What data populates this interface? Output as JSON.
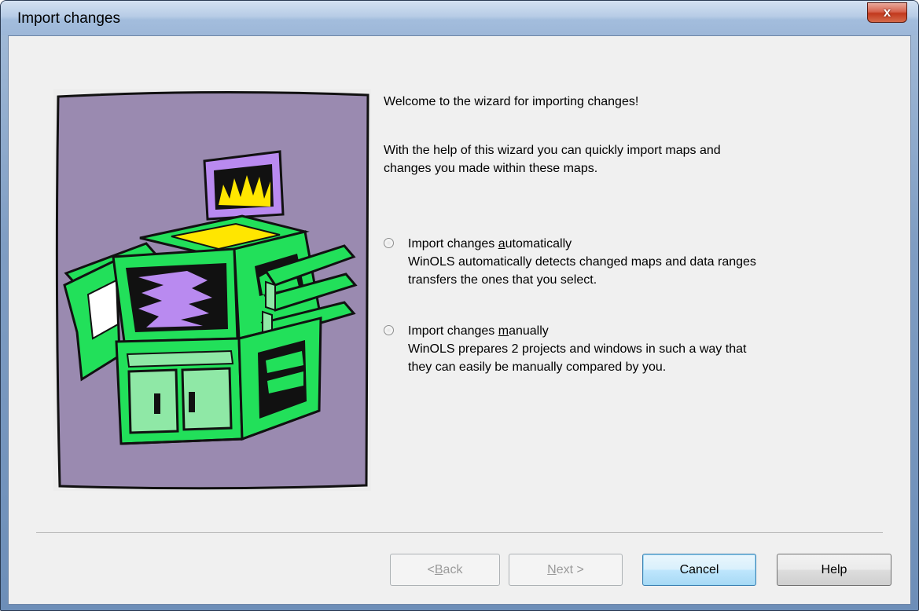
{
  "window": {
    "title": "Import changes",
    "close_glyph": "x"
  },
  "wizard": {
    "welcome": "Welcome to the wizard for importing changes!",
    "help_line1": "With the help of this wizard you can quickly import maps and",
    "help_line2": "changes you made within these maps.",
    "illustration": "printer-illustration-icon"
  },
  "options": [
    {
      "label_pre": "Import changes ",
      "label_accel": "a",
      "label_post": "utomatically",
      "desc_line1": "WinOLS automatically detects changed maps and data ranges",
      "desc_line2": "transfers the ones that you select.",
      "selected": false
    },
    {
      "label_pre": "Import changes ",
      "label_accel": "m",
      "label_post": "anually",
      "desc_line1": "WinOLS prepares 2 projects and windows in such a way that",
      "desc_line2": "they can easily be manually compared by you.",
      "selected": false
    }
  ],
  "buttons": {
    "back_pre": "< ",
    "back_accel": "B",
    "back_post": "ack",
    "next_accel": "N",
    "next_post": "ext >",
    "cancel": "Cancel",
    "help": "Help"
  },
  "colors": {
    "dialog_bg": "#f0f0f0",
    "illustration_bg": "#9a8ab0",
    "printer_green": "#22e05a",
    "default_button_border": "#3c7fb1"
  }
}
